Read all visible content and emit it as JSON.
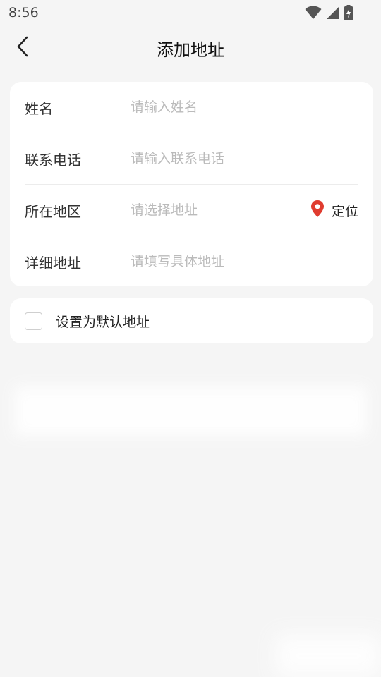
{
  "status_bar": {
    "time": "8:56",
    "icons": [
      "wifi-icon",
      "cellular-signal-icon",
      "battery-charging-icon"
    ]
  },
  "header": {
    "title": "添加地址",
    "back_icon": "chevron-left-icon"
  },
  "form": {
    "name": {
      "label": "姓名",
      "placeholder": "请输入姓名",
      "value": ""
    },
    "phone": {
      "label": "联系电话",
      "placeholder": "请输入联系电话",
      "value": ""
    },
    "region": {
      "label": "所在地区",
      "placeholder": "请选择地址",
      "value": "",
      "locate_label": "定位",
      "locate_icon": "location-pin-icon"
    },
    "detail": {
      "label": "详细地址",
      "placeholder": "请填写具体地址",
      "value": ""
    }
  },
  "default_address": {
    "label": "设置为默认地址",
    "checked": false
  },
  "colors": {
    "background": "#f5f5f5",
    "card": "#ffffff",
    "placeholder": "#bbbbbb",
    "location_pin": "#e03c2f"
  }
}
